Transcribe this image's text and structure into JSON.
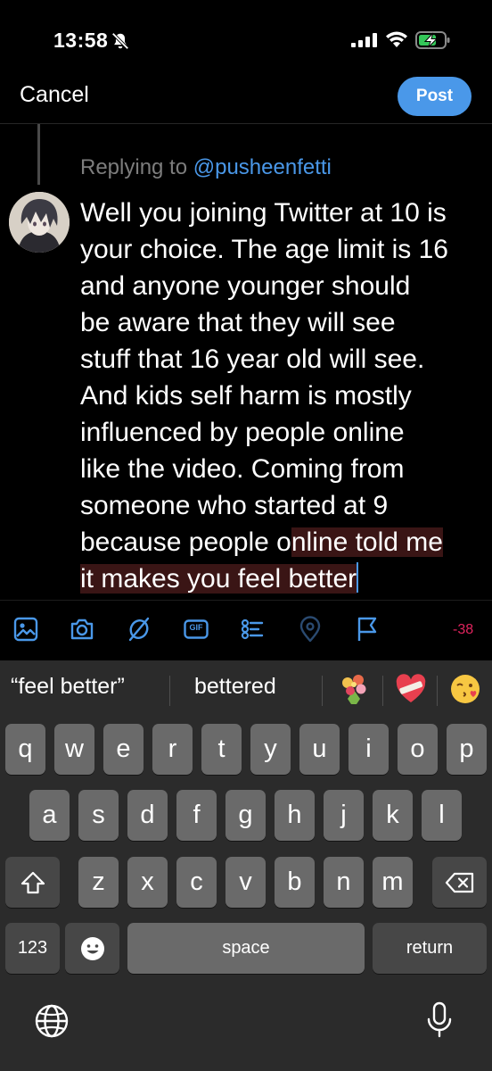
{
  "status_bar": {
    "time": "13:58"
  },
  "header": {
    "cancel_label": "Cancel",
    "post_label": "Post"
  },
  "reply": {
    "prefix": "Replying to ",
    "handle": "@pusheenfetti"
  },
  "tweet": {
    "lines": [
      "Well you joining Twitter at 10 is",
      "your choice. The age limit is 16",
      "and anyone younger should",
      "be aware that they will see",
      "stuff that 16 year old will see.",
      "And kids self harm is mostly",
      "influenced by people online",
      "like the video. Coming from",
      "someone who started at 9"
    ],
    "line10_plain": "because people o",
    "line10_highlight": "nline told me",
    "line11_highlight": "it makes you feel better"
  },
  "toolbar": {
    "icons": [
      "image-icon",
      "camera-icon",
      "no-reply-icon",
      "gif-icon",
      "poll-icon",
      "location-icon",
      "flag-icon"
    ],
    "gif_label": "GIF",
    "char_count": "-38",
    "accent_color": "#4a98e9",
    "over_limit_color": "#e0245e"
  },
  "keyboard": {
    "suggestions": [
      "“feel better”",
      "bettered"
    ],
    "emoji_suggestions": [
      "bouquet-emoji",
      "mending-heart-emoji",
      "face-blowing-kiss-emoji"
    ],
    "row1": [
      "q",
      "w",
      "e",
      "r",
      "t",
      "y",
      "u",
      "i",
      "o",
      "p"
    ],
    "row2": [
      "a",
      "s",
      "d",
      "f",
      "g",
      "h",
      "j",
      "k",
      "l"
    ],
    "row3": [
      "z",
      "x",
      "c",
      "v",
      "b",
      "n",
      "m"
    ],
    "numbers_label": "123",
    "space_label": "space",
    "return_label": "return"
  }
}
